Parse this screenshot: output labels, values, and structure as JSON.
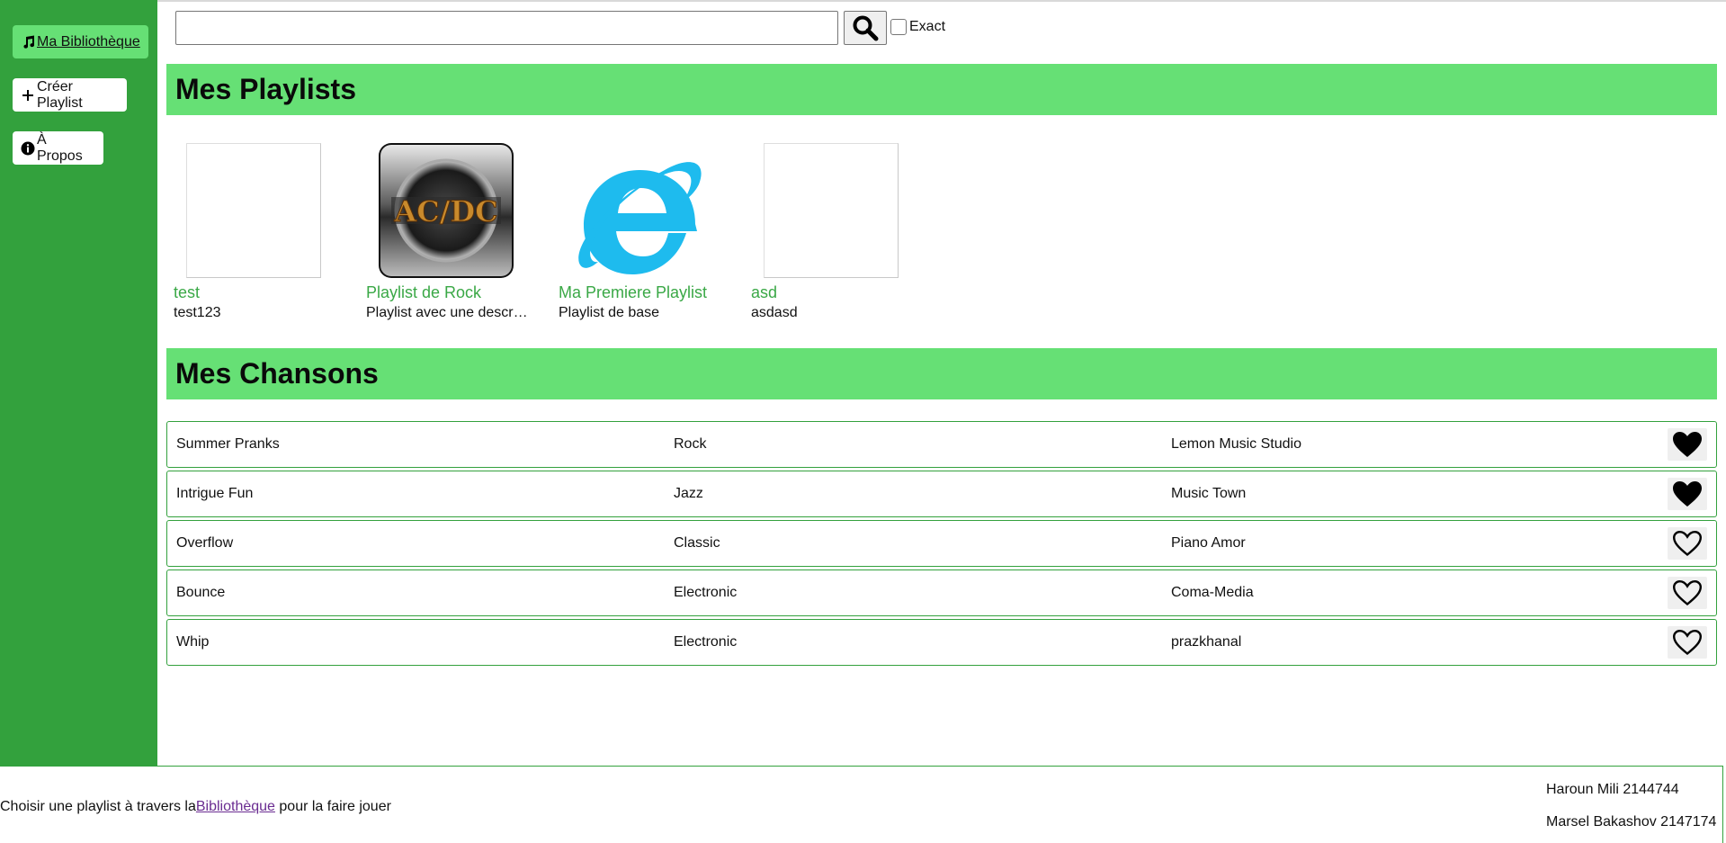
{
  "sidebar": {
    "items": [
      {
        "label": "Ma Bibliothèque",
        "icon": "music-note-icon",
        "active": true
      },
      {
        "label": "Créer Playlist",
        "icon": "plus-icon",
        "active": false
      },
      {
        "label": "À Propos",
        "icon": "info-circle-icon",
        "active": false
      }
    ]
  },
  "search": {
    "value": "",
    "placeholder": "",
    "button_icon": "search-icon",
    "exact_label": "Exact",
    "exact_checked": false
  },
  "playlists_section": {
    "title": "Mes Playlists",
    "items": [
      {
        "name": "test",
        "description": "test123",
        "image": "broken-image"
      },
      {
        "name": "Playlist de Rock",
        "description": "Playlist avec une descr…",
        "image": "acdc-logo"
      },
      {
        "name": "Ma Premiere Playlist",
        "description": "Playlist de base",
        "image": "internet-explorer-logo"
      },
      {
        "name": "asd",
        "description": "asdasd",
        "image": "broken-image"
      }
    ]
  },
  "songs_section": {
    "title": "Mes Chansons",
    "rows": [
      {
        "title": "Summer Pranks",
        "genre": "Rock",
        "artist": "Lemon Music Studio",
        "liked": true
      },
      {
        "title": "Intrigue Fun",
        "genre": "Jazz",
        "artist": "Music Town",
        "liked": true
      },
      {
        "title": "Overflow",
        "genre": "Classic",
        "artist": "Piano Amor",
        "liked": false
      },
      {
        "title": "Bounce",
        "genre": "Electronic",
        "artist": "Coma-Media",
        "liked": false
      },
      {
        "title": "Whip",
        "genre": "Electronic",
        "artist": "prazkhanal",
        "liked": false
      }
    ]
  },
  "footer": {
    "text_before": "Choisir une playlist à travers la",
    "link": "Bibliothèque",
    "text_after": " pour la faire jouer",
    "credits": [
      "Haroun Mili 2144744",
      "Marsel Bakashov 2147174"
    ]
  },
  "colors": {
    "sidebar_bg": "#33a13d",
    "accent_light": "#66e075",
    "playlist_name": "#3aa846",
    "link": "#6a2c91"
  }
}
